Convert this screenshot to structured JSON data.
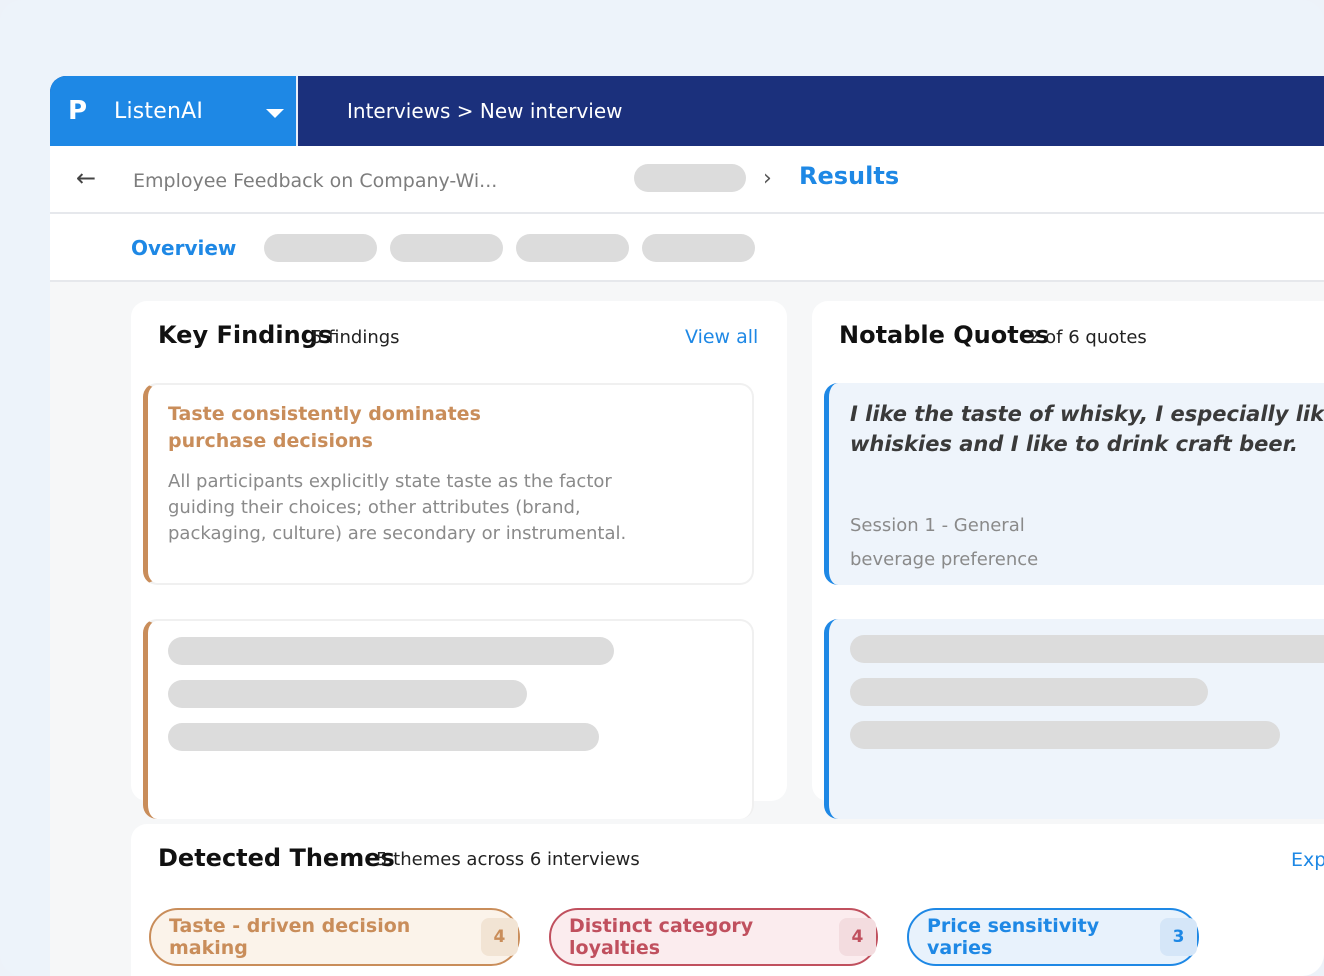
{
  "app": {
    "name": "ListenAI",
    "logo_glyph": "P",
    "breadcrumb": "Interviews > New interview"
  },
  "subheader": {
    "back_glyph": "←",
    "document_title": "Employee Feedback on Company-Wi...",
    "separator": "›",
    "current": "Results"
  },
  "tabs": {
    "active": "Overview"
  },
  "key_findings": {
    "title": "Key Findings",
    "count_label": "5 findings",
    "view_all": "View all",
    "items": [
      {
        "title": "Taste consistently dominates purchase decisions",
        "body": "All participants explicitly state taste as the factor guiding their choices; other attributes (brand, packaging, culture) are secondary or instrumental."
      }
    ]
  },
  "notable_quotes": {
    "title": "Notable Quotes",
    "count_label": "2 of 6 quotes",
    "items": [
      {
        "line1": "I like the taste of whisky, I especially like sing",
        "line2": "whiskies and I like to drink craft beer.",
        "session": "Session 1 - General",
        "topic": "beverage preference"
      }
    ]
  },
  "detected_themes": {
    "title": "Detected Themes",
    "count_label": "5 themes across 6 interviews",
    "action": "Exp",
    "items": [
      {
        "label": "Taste - driven decision making",
        "count": "4"
      },
      {
        "label": "Distinct category loyalties",
        "count": "4"
      },
      {
        "label": "Price sensitivity varies",
        "count": "3"
      }
    ]
  },
  "colors": {
    "brand_blue": "#1e88e5",
    "nav_navy": "#1b307c",
    "finding_accent": "#c98d5a",
    "theme_taste": "#c98d5a",
    "theme_loyalty": "#c0505e",
    "theme_price": "#1e88e5"
  },
  "icons": {
    "brand": "listenai-logo-icon",
    "dropdown": "caret-down-icon",
    "back": "arrow-left-icon",
    "separator": "chevron-right-icon"
  }
}
